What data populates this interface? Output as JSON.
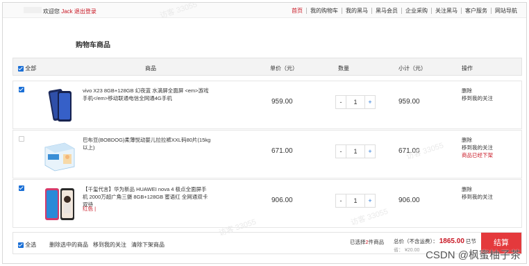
{
  "topbar": {
    "welcome": "欢迎您",
    "username": "Jack",
    "logout": "退出登录",
    "nav": [
      "首页",
      "我的购物车",
      "我的黑马",
      "黑马会员",
      "企业采购",
      "关注黑马",
      "客户服务",
      "网站导航"
    ]
  },
  "section_title": "购物车商品",
  "headers": {
    "select_all": "全部",
    "product": "商品",
    "unit_price": "单价（元）",
    "quantity": "数量",
    "subtotal": "小计（元）",
    "actions": "操作"
  },
  "items": [
    {
      "checked": true,
      "title": "vivo X23 8GB+128GB 幻夜蓝 水滴屏全面屏 <em>游戏手机</em>移动联通电信全网通4G手机",
      "variant": "",
      "price": "959.00",
      "quantity": "1",
      "subtotal": "959.00",
      "actions": [
        "删除",
        "移到我的关注"
      ],
      "warning": ""
    },
    {
      "checked": false,
      "title": "巴布豆(BOBDOG)柔薄悦动婴儿拉拉裤XXL码80片(15kg以上)",
      "variant": "",
      "price": "671.00",
      "quantity": "1",
      "subtotal": "671.00",
      "actions": [
        "删除",
        "移到我的关注"
      ],
      "warning": "商品已经下架"
    },
    {
      "checked": true,
      "title": "【千玺代言】华为新品 HUAWEI nova 4 极点全面屏手机 2000万超广角三摄 8GB+128GB 蜜语红 全网通双卡双待",
      "variant": "红色 |",
      "price": "906.00",
      "quantity": "1",
      "subtotal": "906.00",
      "actions": [
        "删除",
        "移到我的关注"
      ],
      "warning": ""
    }
  ],
  "qty_controls": {
    "minus": "-",
    "plus": "+"
  },
  "footer": {
    "select_all": "全选",
    "delete_selected": "删除选中的商品",
    "move_to_favorites": "移到我的关注",
    "clear_removed": "清除下架商品",
    "selected_count_prefix": "已选择",
    "selected_count": "2",
    "selected_count_suffix": "件商品",
    "total_label": "总价（不含运费）：",
    "total_amount": "1865.00",
    "total_suffix": "已节",
    "shipping_label": "省：",
    "shipping_value": "¥20.00",
    "checkout": "结算"
  },
  "watermark": "访客 33055",
  "csdn_mark": "CSDN @枫蜜柚子茶",
  "colors": {
    "accent_red": "#c81623",
    "checkout_bg": "#e4393c",
    "checkbox_blue": "#1a6fd6"
  }
}
